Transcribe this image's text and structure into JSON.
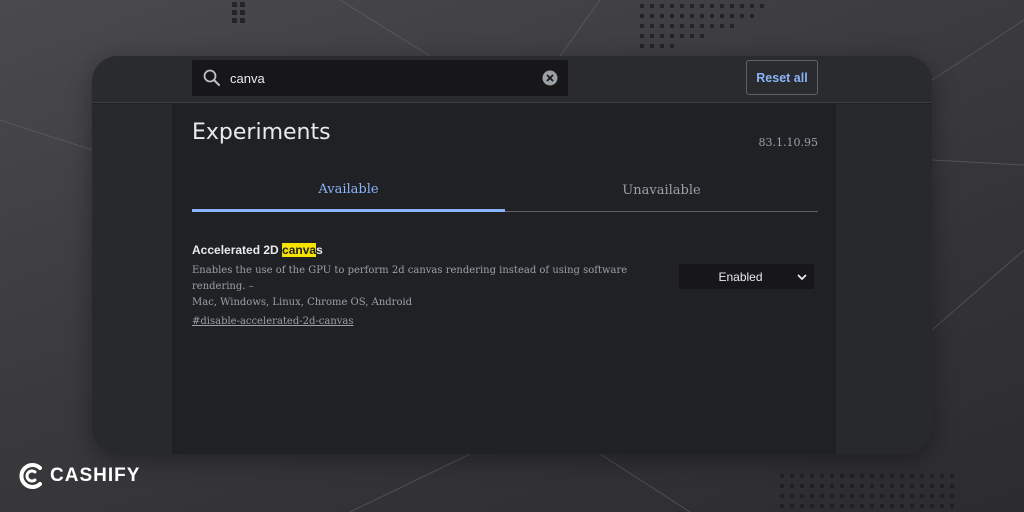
{
  "search": {
    "value": "canva"
  },
  "header": {
    "reset_label": "Reset all"
  },
  "page": {
    "title": "Experiments",
    "version": "83.1.10.95"
  },
  "tabs": [
    {
      "label": "Available",
      "active": true
    },
    {
      "label": "Unavailable",
      "active": false
    }
  ],
  "experiment": {
    "name_before": "Accelerated 2D ",
    "name_highlight": "canva",
    "name_after": "s",
    "description_line1": "Enables the use of the GPU to perform 2d canvas rendering instead of using software rendering. –",
    "description_line2": "Mac, Windows, Linux, Chrome OS, Android",
    "link": "#disable-accelerated-2d-canvas",
    "state": "Enabled"
  },
  "branding": {
    "logo_text": "CASHIFY"
  },
  "colors": {
    "accent": "#8ab4f8",
    "highlight": "#f6e400",
    "panel_bg": "#202124"
  }
}
